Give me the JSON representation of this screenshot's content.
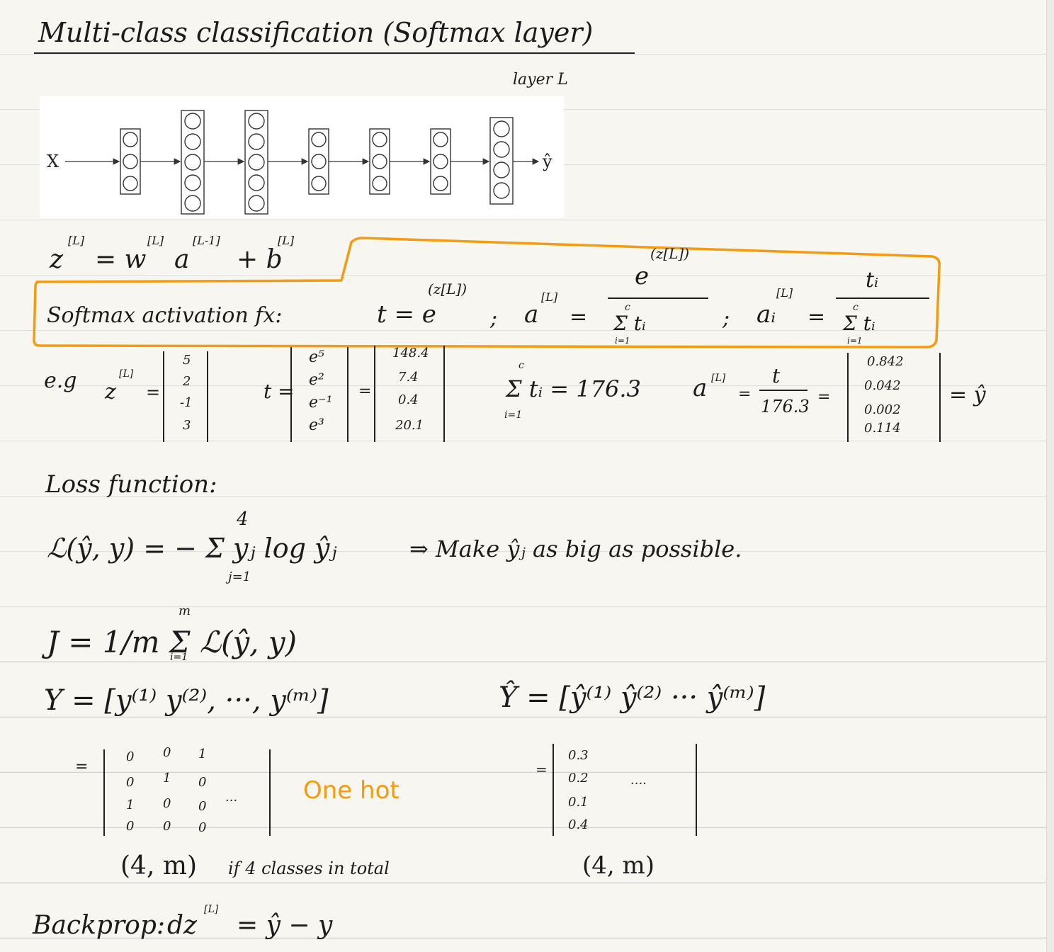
{
  "title": "Multi-class classification (Softmax layer)",
  "network": {
    "input": "X",
    "output": "ŷ",
    "layer_label": "layer L",
    "arrow": "↙"
  },
  "z_eq": {
    "lhs": "z",
    "sup1": "[L]",
    "mid": "= w",
    "sup2": "[L]",
    "a": "a",
    "sup3": "[L-1]",
    "plus": "+ b",
    "sup4": "[L]"
  },
  "softmax": {
    "label": "Softmax activation fx:",
    "t_eq": "t = e",
    "t_sup": "(z[L])",
    "semi1": ";",
    "a_lhs": "a",
    "a_sup": "[L]",
    "eq": "=",
    "frac1_num": "e",
    "frac1_num_sup": "(z[L])",
    "frac1_den": "Σ tᵢ",
    "frac1_den_top": "c",
    "frac1_den_bot": "i=1",
    "semi2": ";",
    "ai_lhs": "aᵢ",
    "ai_sup": "[L]",
    "frac2_num": "tᵢ",
    "frac2_den": "Σ tᵢ",
    "frac2_den_top": "c",
    "frac2_den_bot": "i=1"
  },
  "example": {
    "eg": "e.g",
    "z_lhs": "z",
    "z_sup": "[L]",
    "z_vals": [
      "5",
      "2",
      "-1",
      "3"
    ],
    "t_lhs": "t =",
    "t_exprs": [
      "e⁵",
      "e²",
      "e⁻¹",
      "e³"
    ],
    "t_vals": [
      "148.4",
      "7.4",
      "0.4",
      "20.1"
    ],
    "sum_expr": "Σ tᵢ = 176.3",
    "sum_top": "c",
    "sum_bot": "i=1",
    "a_lhs": "a",
    "a_sup": "[L]",
    "a_num": "t",
    "a_den": "176.3",
    "a_vals": [
      "0.842",
      "0.042",
      "0.002",
      "0.114"
    ],
    "yhat": "= ŷ"
  },
  "loss": {
    "heading": "Loss function:",
    "eq": "ℒ(ŷ, y) = − Σ yⱼ log ŷⱼ",
    "sum_top": "4",
    "sum_bot": "j=1",
    "note": "⇒ Make ŷⱼ as big as possible."
  },
  "cost": {
    "eq": "J = 1/m Σ ℒ(ŷ, y)",
    "frac_num": "1",
    "frac_den": "m",
    "sum_top": "m",
    "sum_bot": "i=1"
  },
  "Y": {
    "lhs": "Y = [y⁽¹⁾  y⁽²⁾, ···, y⁽ᵐ⁾]",
    "matrix_rows": [
      [
        "0",
        "0",
        "1"
      ],
      [
        "0",
        "1",
        "0"
      ],
      [
        "1",
        "0",
        "0"
      ],
      [
        "0",
        "0",
        "0"
      ]
    ],
    "ellipsis": "···",
    "eq": "=",
    "onehot": "One hot",
    "shape": "(4, m)",
    "shape_note": "if 4 classes in total"
  },
  "Yhat": {
    "lhs": "Ŷ = [ŷ⁽¹⁾  ŷ⁽²⁾ ··· ŷ⁽ᵐ⁾]",
    "eq": "=",
    "col": [
      "0.3",
      "0.2",
      "0.1",
      "0.4"
    ],
    "ellipsis": "····",
    "shape": "(4, m)"
  },
  "backprop": {
    "label": "Backprop:",
    "eq": "dz",
    "sup": "[L]",
    "rhs": "= ŷ − y"
  },
  "colors": {
    "accent": "#f39c12",
    "ink": "#1b1b1b"
  }
}
